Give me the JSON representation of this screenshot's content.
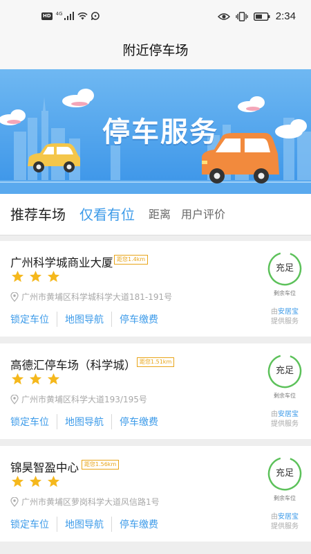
{
  "status_bar": {
    "hd": "HD",
    "network": "4G",
    "time": "2:34"
  },
  "header": {
    "title": "附近停车场"
  },
  "banner": {
    "title": "停车服务"
  },
  "filters": [
    "推荐车场",
    "仅看有位",
    "距离",
    "用户评价"
  ],
  "lots": [
    {
      "name": "广州科学城商业大厦",
      "distance": "距您1.4km",
      "rating": 3,
      "address": "广州市黄埔区科学城科学大道181-191号",
      "status": "充足",
      "remaining_label": "剩余车位",
      "provider_prefix": "由",
      "provider_brand": "安居宝",
      "provider_suffix": "提供服务",
      "actions": [
        "锁定车位",
        "地图导航",
        "停车缴费"
      ]
    },
    {
      "name": "高德汇停车场（科学城）",
      "distance": "距您1.51km",
      "rating": 3,
      "address": "广州市黄埔区科学大道193/195号",
      "status": "充足",
      "remaining_label": "剩余车位",
      "provider_prefix": "由",
      "provider_brand": "安居宝",
      "provider_suffix": "提供服务",
      "actions": [
        "锁定车位",
        "地图导航",
        "停车缴费"
      ]
    },
    {
      "name": "锦昊智盈中心",
      "distance": "距您1.56km",
      "rating": 3,
      "address": "广州市黄埔区萝岗科学大道风信路1号",
      "status": "充足",
      "remaining_label": "剩余车位",
      "provider_prefix": "由",
      "provider_brand": "安居宝",
      "provider_suffix": "提供服务",
      "actions": [
        "锁定车位",
        "地图导航",
        "停车缴费"
      ]
    }
  ],
  "colors": {
    "accent": "#3d9be9",
    "ring": "#5cc15a",
    "star": "#f5b81c",
    "distance": "#e8a417"
  }
}
